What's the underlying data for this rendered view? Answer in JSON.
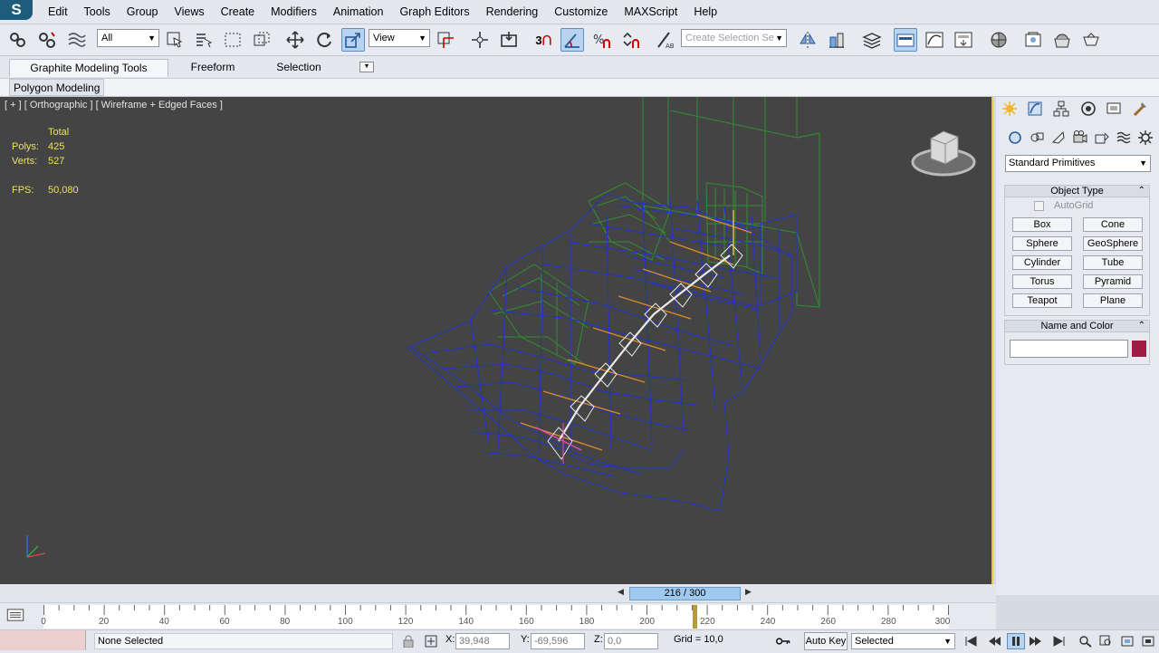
{
  "app": {
    "logo": "S"
  },
  "menu": [
    "Edit",
    "Tools",
    "Group",
    "Views",
    "Create",
    "Modifiers",
    "Animation",
    "Graph Editors",
    "Rendering",
    "Customize",
    "MAXScript",
    "Help"
  ],
  "toolbar": {
    "selection_filter": "All",
    "ref_coord": "View",
    "snap_label": "3",
    "named_selection_placeholder": "Create Selection Se"
  },
  "ribbon": {
    "tabs": [
      "Graphite Modeling Tools",
      "Freeform",
      "Selection"
    ],
    "active_panel": "Polygon Modeling"
  },
  "viewport": {
    "label": "[ + ] [ Orthographic ] [ Wireframe + Edged Faces ]",
    "stats": {
      "total_label": "Total",
      "polys_label": "Polys:",
      "polys": "425",
      "verts_label": "Verts:",
      "verts": "527",
      "fps_label": "FPS:",
      "fps": "50,080"
    }
  },
  "command_panel": {
    "dropdown": "Standard Primitives",
    "object_type": {
      "title": "Object Type",
      "autogrid": "AutoGrid",
      "buttons": [
        "Box",
        "Cone",
        "Sphere",
        "GeoSphere",
        "Cylinder",
        "Tube",
        "Torus",
        "Pyramid",
        "Teapot",
        "Plane"
      ]
    },
    "name_color": {
      "title": "Name and Color",
      "color": "#a01a45"
    }
  },
  "timeline": {
    "frame_display": "216 / 300",
    "ticks": [
      "0",
      "20",
      "40",
      "60",
      "80",
      "100",
      "120",
      "140",
      "160",
      "180",
      "200",
      "220",
      "240",
      "260",
      "280",
      "300"
    ]
  },
  "status": {
    "selection": "None Selected",
    "x_label": "X:",
    "x": "39,948",
    "y_label": "Y:",
    "y": "-69,596",
    "z_label": "Z:",
    "z": "0,0",
    "grid": "Grid = 10,0",
    "autokey": "Auto Key",
    "key_filter": "Selected"
  },
  "colors": {
    "viewport_bg": "#444444",
    "wire_blue": "#2233cc",
    "wire_green": "#2f8f2f",
    "active_border": "#e8c64a"
  }
}
